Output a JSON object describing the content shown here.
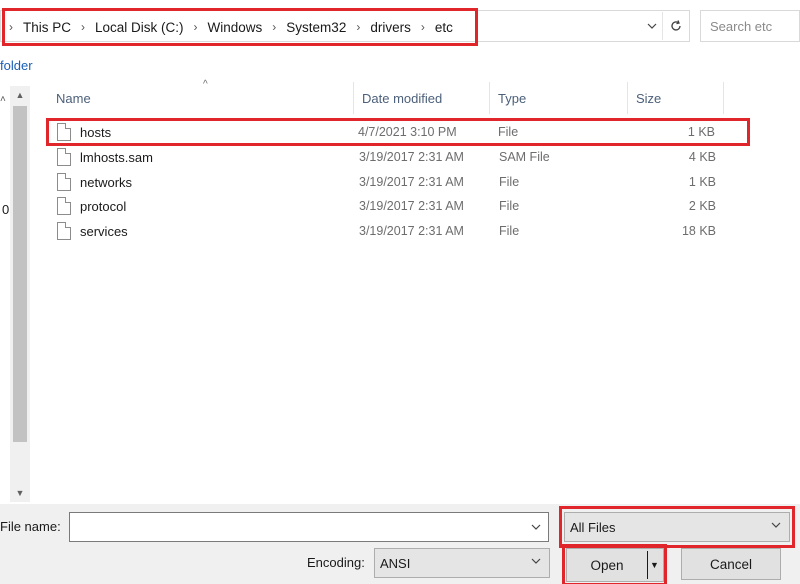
{
  "address_bar": {
    "breadcrumbs": [
      "This PC",
      "Local Disk (C:)",
      "Windows",
      "System32",
      "drivers",
      "etc"
    ],
    "search_placeholder": "Search etc"
  },
  "toolbar": {
    "new_folder_label": "folder"
  },
  "nav": {
    "fragment_text": "0"
  },
  "file_list": {
    "columns": {
      "name": "Name",
      "date": "Date modified",
      "type": "Type",
      "size": "Size"
    },
    "rows": [
      {
        "name": "hosts",
        "date": "4/7/2021 3:10 PM",
        "type": "File",
        "size": "1 KB",
        "highlighted": true
      },
      {
        "name": "lmhosts.sam",
        "date": "3/19/2017 2:31 AM",
        "type": "SAM File",
        "size": "4 KB"
      },
      {
        "name": "networks",
        "date": "3/19/2017 2:31 AM",
        "type": "File",
        "size": "1 KB"
      },
      {
        "name": "protocol",
        "date": "3/19/2017 2:31 AM",
        "type": "File",
        "size": "2 KB"
      },
      {
        "name": "services",
        "date": "3/19/2017 2:31 AM",
        "type": "File",
        "size": "18 KB"
      }
    ]
  },
  "bottom": {
    "file_name_label": "File name:",
    "file_name_value": "",
    "filter_value": "All Files",
    "encoding_label": "Encoding:",
    "encoding_value": "ANSI",
    "open_label": "Open",
    "cancel_label": "Cancel"
  },
  "colors": {
    "annotation_red": "#e0262b",
    "header_text": "#4c607a",
    "link_blue": "#1a5fb4"
  },
  "icons": [
    "chevron-right-icon",
    "chevron-down-icon",
    "refresh-icon",
    "file-icon",
    "sort-up-icon",
    "scroll-up-icon",
    "scroll-down-icon"
  ]
}
